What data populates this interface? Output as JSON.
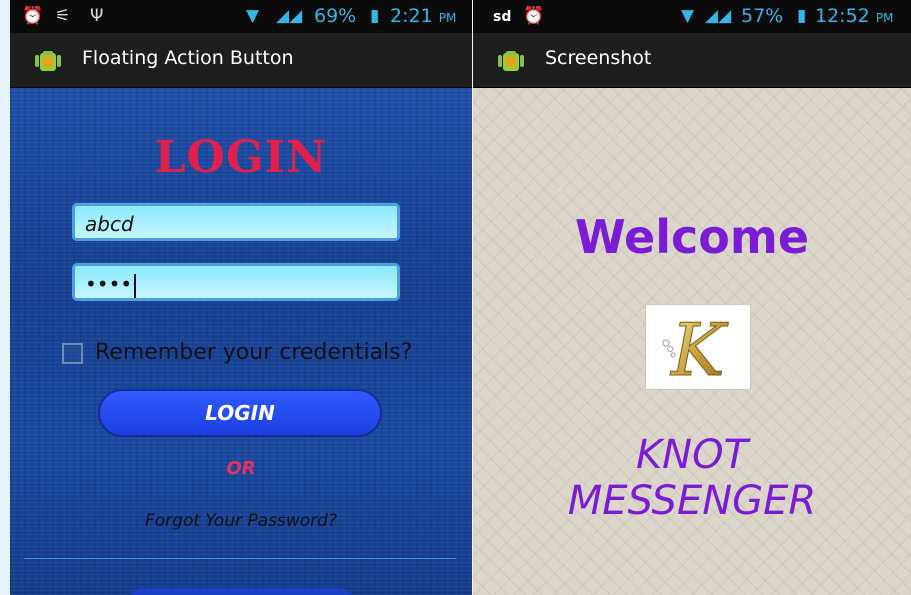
{
  "left_phone": {
    "status": {
      "time": "2:21",
      "ampm": "PM",
      "battery": "69%"
    },
    "app_title": "Floating Action Button",
    "login_heading": "LOGIN",
    "username_value": "abcd",
    "password_masked": "••••",
    "remember_label": "Remember your credentials?",
    "login_button": "LOGIN",
    "or_text": "OR",
    "forgot_link": "Forgot Your Password?"
  },
  "right_phone": {
    "status": {
      "carrier": "sd",
      "time": "12:52",
      "ampm": "PM",
      "battery": "57%"
    },
    "app_title": "Screenshot",
    "welcome": "Welcome",
    "logo_letter": "K",
    "app_name_line1": "KNOT",
    "app_name_line2": "MESSENGER"
  },
  "colors": {
    "accent_pink": "#e0204a",
    "purple": "#7a1bd6",
    "status_blue": "#33b5e5"
  },
  "icons": [
    "alarm-icon",
    "wifi-icon",
    "usb-icon",
    "signal-icon",
    "battery-icon",
    "android-logo-icon"
  ]
}
